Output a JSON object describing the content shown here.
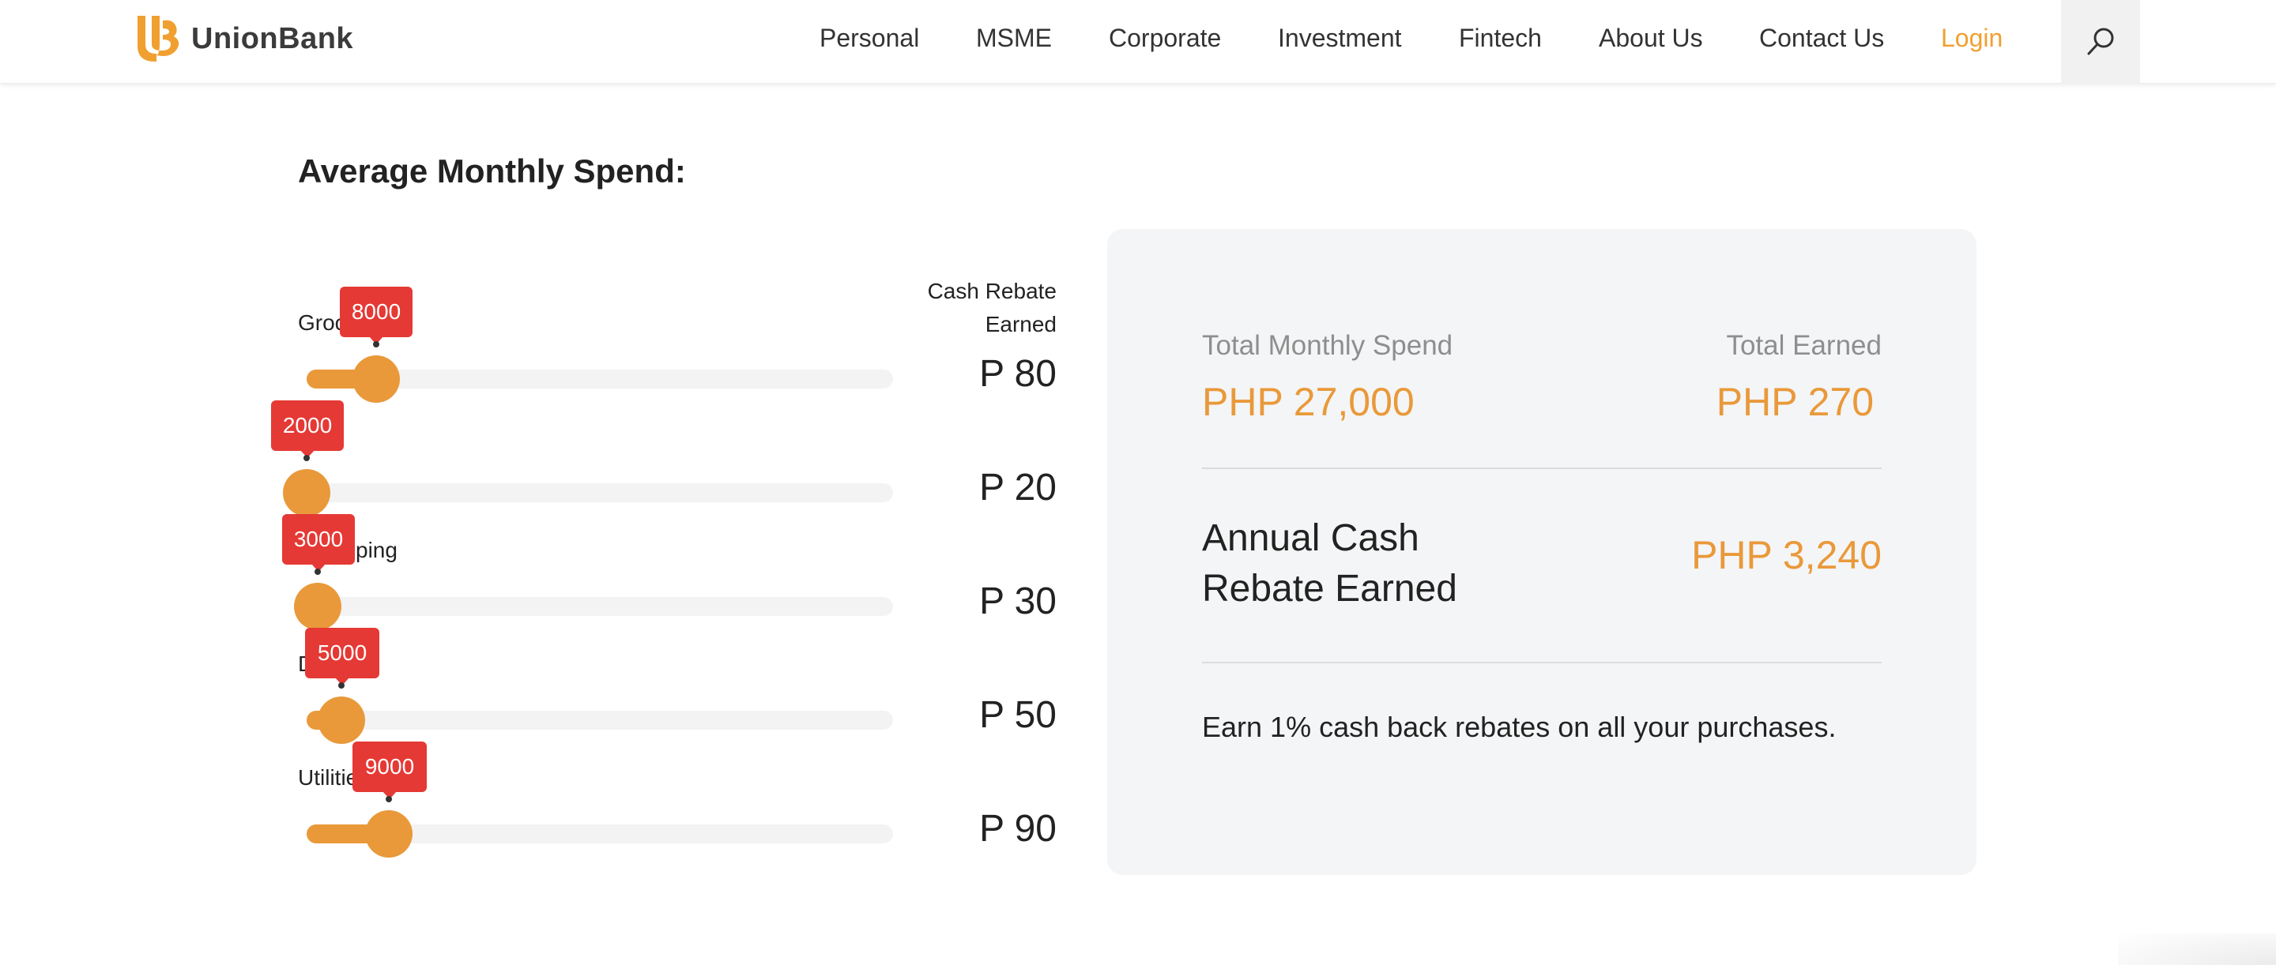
{
  "brand": {
    "name": "UnionBank",
    "accent": "#f0a030",
    "slider_color": "#e9993a",
    "tooltip_color": "#e53935"
  },
  "nav": {
    "items": [
      {
        "label": "Personal"
      },
      {
        "label": "MSME"
      },
      {
        "label": "Corporate"
      },
      {
        "label": "Investment"
      },
      {
        "label": "Fintech"
      },
      {
        "label": "About Us"
      },
      {
        "label": "Contact Us"
      }
    ],
    "login": "Login",
    "search_icon": "search-icon"
  },
  "calculator": {
    "title": "Average Monthly Spend:",
    "rebate_header": "Cash Rebate Earned",
    "sliders": [
      {
        "label_visible": "Groc",
        "value": "8000",
        "level": 0.16,
        "rebate": "P 80"
      },
      {
        "label_visible": "",
        "value": "2000",
        "level": 0.0,
        "rebate": "P 20"
      },
      {
        "label_visible": "ping",
        "value": "3000",
        "level": 0.02,
        "rebate": "P 30"
      },
      {
        "label_visible": "D",
        "value": "5000",
        "level": 0.06,
        "rebate": "P 50"
      },
      {
        "label_visible": "Utilitie",
        "value": "9000",
        "level": 0.14,
        "rebate": "P 90"
      }
    ]
  },
  "summary": {
    "total_spend_label": "Total Monthly Spend",
    "total_spend_value": "PHP 27,000",
    "total_earned_label": "Total Earned",
    "total_earned_value": "PHP 270",
    "annual_label": "Annual Cash Rebate Earned",
    "annual_value": "PHP 3,240",
    "note": "Earn 1% cash back rebates on all your purchases."
  }
}
